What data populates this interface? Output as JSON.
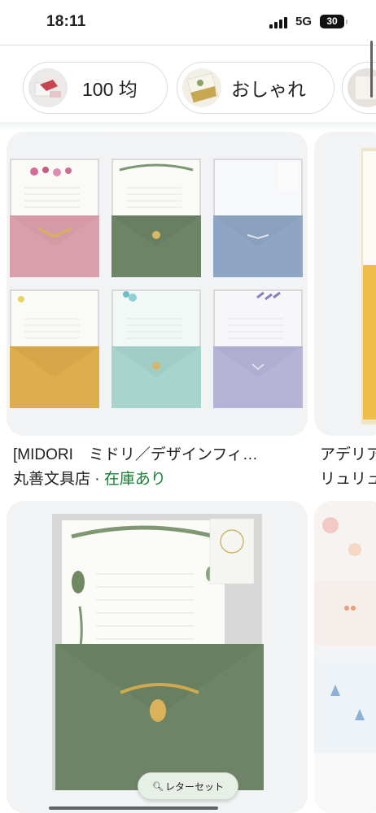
{
  "status_bar": {
    "time": "18:11",
    "network": "5G",
    "battery_level": "30"
  },
  "chips": [
    {
      "label": "100 均",
      "thumb_icon": "stationery-thumbnail"
    },
    {
      "label": "おしゃれ",
      "thumb_icon": "letterset-thumbnail"
    }
  ],
  "results": [
    {
      "title": "[MIDORI　ミドリ／デザインフィ…",
      "seller": "丸善文具店",
      "separator": "·",
      "stock": "在庫あり"
    },
    {
      "title": "アデリア",
      "seller": "リュリュ"
    }
  ],
  "floating_search": {
    "icon": "search-icon",
    "label": "レターセット"
  },
  "colors": {
    "envelope_pink": "#d9a0ac",
    "envelope_green": "#6e8466",
    "envelope_blue": "#8ea6c3",
    "envelope_yellow": "#dcae4c",
    "envelope_mint": "#a7d4cd",
    "envelope_lavender": "#b5b4d6",
    "stock_green": "#188038"
  }
}
